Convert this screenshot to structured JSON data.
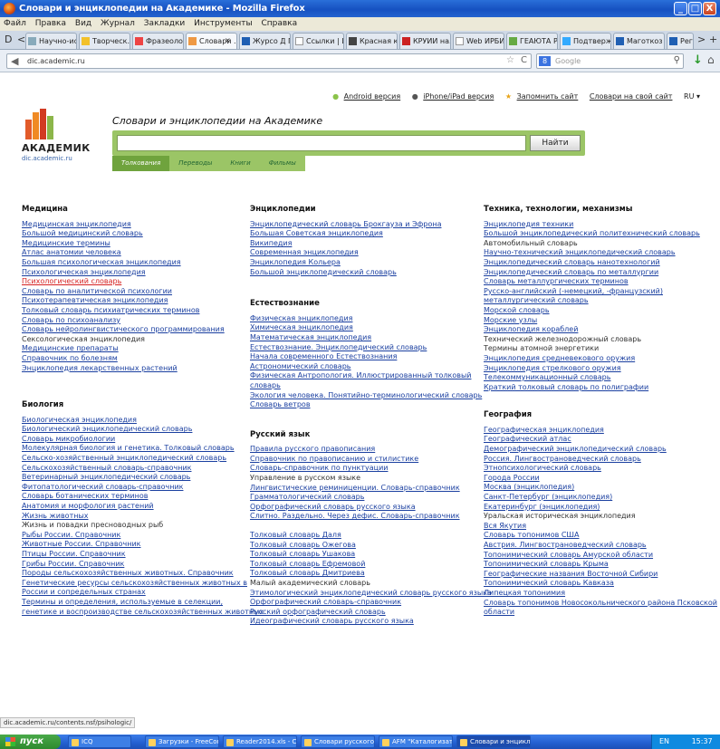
{
  "window": {
    "title": "Словари и энциклопедии на Академике - Mozilla Firefox",
    "min": "_",
    "max": "□",
    "close": "X"
  },
  "menu": [
    "Файл",
    "Правка",
    "Вид",
    "Журнал",
    "Закладки",
    "Инструменты",
    "Справка"
  ],
  "tabs": [
    "Научно-иссл...",
    "Творческ...",
    "Фразеолог...",
    "Словари ...",
    "Журсо Д Г...",
    "Ссылки | ЦБ...",
    "Красная к...",
    "КРУИИ на...",
    "Web ИРБИС",
    "ГЕАЮТА Р...",
    "Подтвержд...",
    "Маготкоз А...",
    "Регистрация"
  ],
  "tab_close": "×",
  "nav": {
    "new_tab": "+",
    "scroll_left": "<",
    "scroll_right": ">",
    "menu_icon": "D"
  },
  "address": {
    "url": "dic.academic.ru",
    "back": "◀",
    "star": "☆",
    "dropdown": "▾",
    "reload": "C"
  },
  "search": {
    "placeholder": "Google",
    "engine": "8",
    "go": "⚲"
  },
  "toolbar_icons": {
    "download": "↓",
    "home": "⌂"
  },
  "toplinks": {
    "android": "Android версия",
    "iphone": "iPhone/iPad версия",
    "remember": "Запомнить сайт",
    "home": "Словари на свой сайт",
    "lang": "RU ▾",
    "android_icon": "●",
    "iphone_icon": "●",
    "star_icon": "★"
  },
  "logo": {
    "name": "АКАДЕМИК",
    "url": "dic.academic.ru"
  },
  "site_title": "Словари и энциклопедии на Академике",
  "search_button": "Найти",
  "category_tabs": [
    "Толкования",
    "Переводы",
    "Книги",
    "Фильмы"
  ],
  "columns": [
    [
      {
        "title": "Медицина",
        "links": [
          "Медицинская энциклопедия",
          "Большой медицинский словарь",
          "Медицинские термины",
          "Атлас анатомии человека",
          "Большая психологическая энциклопедия",
          "Психологическая энциклопедия",
          "Психологический словарь",
          "Словарь по аналитической психологии",
          "Психотерапевтическая энциклопедия",
          "Толковый словарь психиатрических терминов",
          "Словарь по психоанализу",
          "Словарь нейролингвистического программирования",
          "Сексологическая энциклопедия",
          "Медицинские препараты",
          "Справочник по болезням",
          "Энциклопедия лекарственных растений"
        ]
      },
      {
        "title": "Биология",
        "links": [
          "Биологическая энциклопедия",
          "Биологический энциклопедический словарь",
          "Словарь микробиологии",
          "Молекулярная биология и генетика. Толковый словарь",
          "Сельско-хозяйственный энциклопедический словарь",
          "Сельскохозяйственный словарь-справочник",
          "Ветеринарный энциклопедический словарь",
          "Фитопатологический словарь-справочник",
          "Словарь ботанических терминов",
          "Анатомия и морфология растений",
          "Жизнь животных",
          "Жизнь и повадки пресноводных рыб",
          "Рыбы России. Справочник",
          "Животные России. Справочник",
          "Птицы России. Справочник",
          "Грибы России. Справочник",
          "Породы сельскохозяйственных животных. Справочник",
          "Генетические ресурсы сельскохозяйственных животных в",
          "России и сопредельных странах",
          "Термины и определения, используемые в селекции,",
          "генетике и воспроизводстве сельскохозяйственных животных"
        ]
      }
    ],
    [
      {
        "title": "Энциклопедии",
        "links": [
          "Энциклопедический словарь Брокгауза и Эфрона",
          "Большая Советская энциклопедия",
          "Википедия",
          "Современная энциклопедия",
          "Энциклопедия Кольера",
          "Большой энциклопедический словарь"
        ]
      },
      {
        "title": "Естествознание",
        "links": [
          "Физическая энциклопедия",
          "Химическая энциклопедия",
          "Математическая энциклопедия",
          "Естествознание. Энциклопедический словарь",
          "Начала современного Естествознания",
          "Астрономический словарь",
          "Физическая Антропология. Иллюстрированный толковый",
          "словарь",
          "Экология человека. Понятийно-терминологический словарь",
          "Словарь ветров"
        ]
      },
      {
        "title": "Русский язык",
        "links": [
          "Правила русского правописания",
          "Справочник по правописанию и стилистике",
          "Словарь-справочник по пунктуации",
          "Управление в русском языке",
          "Лингвистические реминиценции. Словарь-справочник",
          "Грамматологический словарь",
          "Орфографический словарь русского языка",
          "Слитно. Раздельно. Через дефис. Словарь-справочник",
          "",
          "Толковый словарь Даля",
          "Толковый словарь Ожегова",
          "Толковый словарь Ушакова",
          "Толковый словарь Ефремовой",
          "Толковый словарь Дмитриева",
          "Малый академический словарь",
          "Этимологический энциклопедический словарь русского языка",
          "Орфографический словарь-справочник",
          "Русский орфографический словарь",
          "Идеографический словарь русского языка"
        ]
      }
    ],
    [
      {
        "title": "Техника, технологии, механизмы",
        "links": [
          "Энциклопедия техники",
          "Большой энциклопедический политехнический словарь",
          "Автомобильный словарь",
          "Научно-технический энциклопедический словарь",
          "Энциклопедический словарь нанотехнологий",
          "Энциклопедический словарь по металлургии",
          "Словарь металлургических терминов",
          "Русско-английский (-немецкий, -французский)",
          "металлургический словарь",
          "Морской словарь",
          "Морские узлы",
          "Энциклопедия кораблей",
          "Технический железнодорожный словарь",
          "Термины атомной энергетики",
          "Энциклопедия средневекового оружия",
          "Энциклопедия стрелкового оружия",
          "Телекоммуникационный словарь",
          "Краткий толковый словарь по полиграфии"
        ]
      },
      {
        "title": "География",
        "links": [
          "Географическая энциклопедия",
          "Географический атлас",
          "Демографический энциклопедический словарь",
          "Россия. Лингвострановедческий словарь",
          "Этнопсихологический словарь",
          "Города России",
          "Москва (энциклопедия)",
          "Санкт-Петербург (энциклопедия)",
          "Екатеринбург (энциклопедия)",
          "Уральская историческая энциклопедия",
          "Вся Якутия",
          "Словарь топонимов США",
          "Австрия. Лингвострановедческий словарь",
          "Топонимический словарь Амурской области",
          "Топонимический словарь Крыма",
          "Географические названия Восточной Сибири",
          "Топонимический словарь Кавказа",
          "Липецкая топонимия",
          "Словарь топонимов Новосокольнического района Псковской",
          "области"
        ]
      }
    ]
  ],
  "status_url": "dic.academic.ru/contents.nsf/psihologic/",
  "taskbar": {
    "start": "пуск",
    "tasks": [
      "ICQ",
      "Загрузки - FreeCom...",
      "Reader2014.xls - Co...",
      "Словари русского я...",
      "AFM \"Каталогизато...",
      "Словари и энциклоп..."
    ],
    "tray_lang": "EN",
    "time": "15:37"
  },
  "colors": {
    "accent_green": "#9bc566",
    "active_green": "#6fa33d",
    "link_blue": "#1a3fa0",
    "link_visited_red": "#d62222",
    "xp_blue": "#235fd0"
  }
}
